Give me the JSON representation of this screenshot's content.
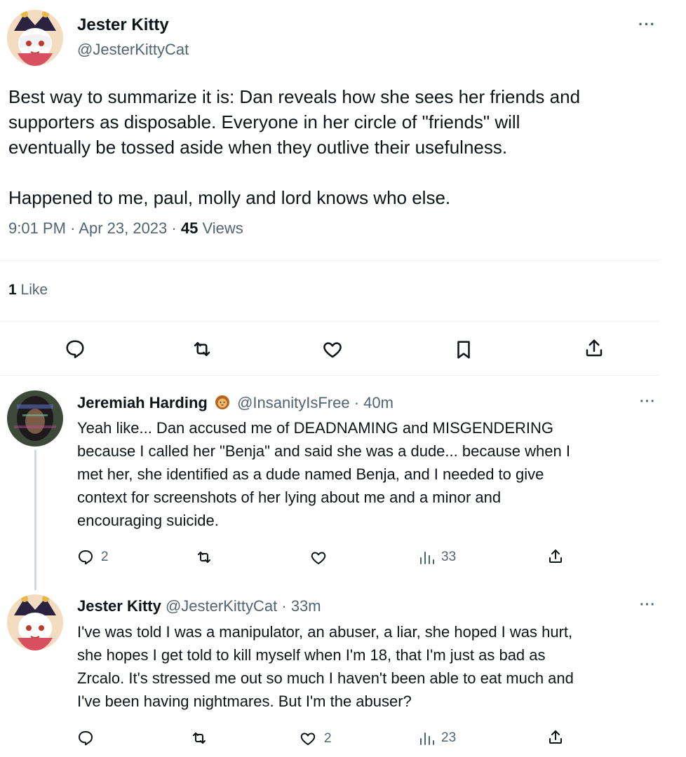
{
  "main_tweet": {
    "author_name": "Jester Kitty",
    "author_handle": "@JesterKittyCat",
    "text_lines": [
      "Best way to summarize it is: Dan reveals how she sees her friends and",
      "supporters as disposable. Everyone in her circle of \"friends\" will",
      "eventually be tossed aside when they outlive their usefulness."
    ],
    "text_line_2": "Happened to me, paul, molly and lord knows who else.",
    "time": "9:01 PM",
    "date": "Apr 23, 2023",
    "views_count": "45",
    "views_label": "Views",
    "likes_count": "1",
    "likes_label": "Like"
  },
  "replies": [
    {
      "author_name": "Jeremiah Harding",
      "author_handle": "@InsanityIsFree",
      "time_ago": "40m",
      "text_lines": [
        "Yeah like... Dan accused me of DEADNAMING and MISGENDERING",
        "because I called her \"Benja\" and said she was a dude... because when I",
        "met her, she identified as a dude named Benja, and I needed to give",
        "context for screenshots of her lying about me and a minor and",
        "encouraging suicide."
      ],
      "reply_count": "2",
      "retweet_count": "",
      "like_count": "",
      "view_count": "33"
    },
    {
      "author_name": "Jester Kitty",
      "author_handle": "@JesterKittyCat",
      "time_ago": "33m",
      "text_lines": [
        "I've was told I was a manipulator, an abuser, a liar, she hoped I was hurt,",
        "she hopes I get told to kill myself when I'm 18, that I'm just as bad as",
        "Zrcalo. It's stressed me out so much I haven't been able to eat much and",
        "I've been having nightmares. But I'm the abuser?"
      ],
      "reply_count": "",
      "retweet_count": "",
      "like_count": "2",
      "view_count": "23"
    }
  ],
  "more_glyph": "···",
  "separator": "·",
  "colors": {
    "text": "#0f1419",
    "secondary": "#536471",
    "divider": "#eff3f4",
    "thread_line": "#cfd9de"
  },
  "icons": [
    "reply-icon",
    "retweet-icon",
    "like-icon",
    "bookmark-icon",
    "share-icon",
    "views-icon",
    "more-icon"
  ]
}
